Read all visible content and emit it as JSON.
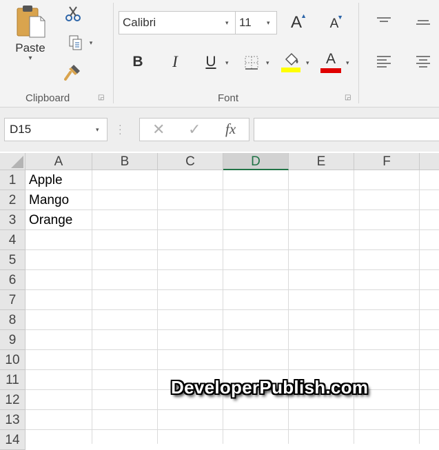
{
  "ribbon": {
    "clipboard": {
      "paste_label": "Paste",
      "group_label": "Clipboard",
      "icons": [
        "paste-icon",
        "cut-icon",
        "copy-icon",
        "format-painter-icon"
      ]
    },
    "font": {
      "font_name": "Calibri",
      "font_size": "11",
      "grow_font": "A",
      "shrink_font": "A",
      "bold": "B",
      "italic": "I",
      "underline": "U",
      "font_color_letter": "A",
      "group_label": "Font",
      "highlight_color": "#ffff00",
      "font_color": "#e00000"
    },
    "alignment": {
      "icons": [
        "align-top-icon",
        "align-middle-icon",
        "align-left-icon",
        "align-center-icon"
      ]
    }
  },
  "formula_bar": {
    "name_box": "D15",
    "fx_label": "fx",
    "formula_value": ""
  },
  "sheet": {
    "columns": [
      "A",
      "B",
      "C",
      "D",
      "E",
      "F"
    ],
    "rows": [
      "1",
      "2",
      "3",
      "4",
      "5",
      "6",
      "7",
      "8",
      "9",
      "10",
      "11",
      "12",
      "13",
      "14"
    ],
    "cells": {
      "A1": "Apple",
      "A2": "Mango",
      "A3": "Orange"
    },
    "active_column": "D",
    "accent_color": "#217346"
  },
  "watermark": "DeveloperPublish.com"
}
